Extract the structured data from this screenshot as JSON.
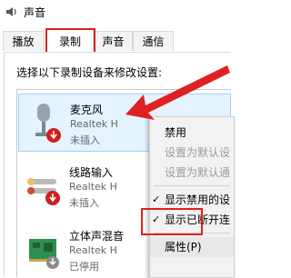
{
  "window": {
    "title": "声音",
    "icon": "speaker-icon"
  },
  "tabs": [
    {
      "label": "播放",
      "active": false
    },
    {
      "label": "录制",
      "active": true
    },
    {
      "label": "声音",
      "active": false
    },
    {
      "label": "通信",
      "active": false
    }
  ],
  "instruction": "选择以下录制设备来修改设置:",
  "devices": [
    {
      "name": "麦克风",
      "line2": "Realtek H",
      "status": "未插入",
      "icon": "microphone-icon",
      "selected": true
    },
    {
      "name": "线路输入",
      "line2": "Realtek H",
      "status": "未插入",
      "icon": "line-in-jack-icon",
      "selected": false
    },
    {
      "name": "立体声混音",
      "line2": "Realtek H",
      "status": "已停用",
      "icon": "sound-card-icon",
      "selected": false
    }
  ],
  "context_menu": {
    "items": [
      {
        "label": "禁用",
        "disabled": false,
        "checked": false
      },
      {
        "label": "设置为默认设",
        "disabled": true,
        "checked": false
      },
      {
        "label": "设置为默认通",
        "disabled": true,
        "checked": false
      },
      {
        "label": "显示禁用的设",
        "disabled": false,
        "checked": true
      },
      {
        "label": "显示已断开连",
        "disabled": false,
        "checked": true
      },
      {
        "label": "属性(P)",
        "disabled": false,
        "checked": false
      }
    ]
  },
  "colors": {
    "highlight": "#e02020",
    "selection": "#e5f3ff",
    "status_badge": "#d11f1f"
  }
}
